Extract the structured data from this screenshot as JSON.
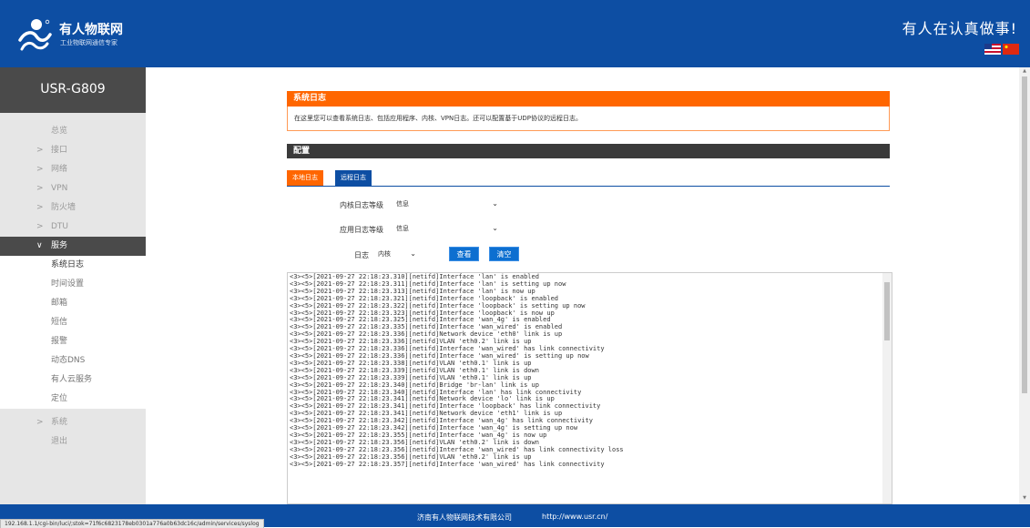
{
  "header": {
    "brand_title": "有人物联网",
    "brand_subtitle": "工业物联网通信专家",
    "slogan": "有人在认真做事!"
  },
  "sidebar": {
    "device_name": "USR-G809",
    "items": [
      {
        "label": "总览",
        "chevron": ""
      },
      {
        "label": "接口",
        "chevron": ">"
      },
      {
        "label": "网络",
        "chevron": ">"
      },
      {
        "label": "VPN",
        "chevron": ">"
      },
      {
        "label": "防火墙",
        "chevron": ">"
      },
      {
        "label": "DTU",
        "chevron": ">"
      },
      {
        "label": "服务",
        "chevron": "∨"
      },
      {
        "label": "系统日志"
      },
      {
        "label": "时间设置"
      },
      {
        "label": "邮箱"
      },
      {
        "label": "短信"
      },
      {
        "label": "报警"
      },
      {
        "label": "动态DNS"
      },
      {
        "label": "有人云服务"
      },
      {
        "label": "定位"
      },
      {
        "label": "系统",
        "chevron": ">"
      },
      {
        "label": "退出"
      }
    ]
  },
  "main": {
    "card_title": "系统日志",
    "card_desc": "在这里您可以查看系统日志、包括应用程序、内核、VPN日志。还可以配置基于UDP协议的远程日志。",
    "section_title": "配置",
    "tabs": [
      {
        "label": "本地日志"
      },
      {
        "label": "远程日志"
      }
    ],
    "kernel_level_label": "内核日志等级",
    "kernel_level_value": "信息",
    "app_level_label": "应用日志等级",
    "app_level_value": "信息",
    "log_label": "日志",
    "log_source_value": "内核",
    "view_button": "查看",
    "clear_button": "清空",
    "log_lines": "<3><5>[2021-09-27 22:18:23.310][netifd]Interface 'lan' is enabled\n<3><5>[2021-09-27 22:18:23.311][netifd]Interface 'lan' is setting up now\n<3><5>[2021-09-27 22:18:23.313][netifd]Interface 'lan' is now up\n<3><5>[2021-09-27 22:18:23.321][netifd]Interface 'loopback' is enabled\n<3><5>[2021-09-27 22:18:23.322][netifd]Interface 'loopback' is setting up now\n<3><5>[2021-09-27 22:18:23.323][netifd]Interface 'loopback' is now up\n<3><5>[2021-09-27 22:18:23.325][netifd]Interface 'wan_4g' is enabled\n<3><5>[2021-09-27 22:18:23.335][netifd]Interface 'wan_wired' is enabled\n<3><5>[2021-09-27 22:18:23.336][netifd]Network device 'eth0' link is up\n<3><5>[2021-09-27 22:18:23.336][netifd]VLAN 'eth0.2' link is up\n<3><5>[2021-09-27 22:18:23.336][netifd]Interface 'wan_wired' has link connectivity\n<3><5>[2021-09-27 22:18:23.336][netifd]Interface 'wan_wired' is setting up now\n<3><5>[2021-09-27 22:18:23.338][netifd]VLAN 'eth0.1' link is up\n<3><5>[2021-09-27 22:18:23.339][netifd]VLAN 'eth0.1' link is down\n<3><5>[2021-09-27 22:18:23.339][netifd]VLAN 'eth0.1' link is up\n<3><5>[2021-09-27 22:18:23.340][netifd]Bridge 'br-lan' link is up\n<3><5>[2021-09-27 22:18:23.340][netifd]Interface 'lan' has link connectivity\n<3><5>[2021-09-27 22:18:23.341][netifd]Network device 'lo' link is up\n<3><5>[2021-09-27 22:18:23.341][netifd]Interface 'loopback' has link connectivity\n<3><5>[2021-09-27 22:18:23.341][netifd]Network device 'eth1' link is up\n<3><5>[2021-09-27 22:18:23.342][netifd]Interface 'wan_4g' has link connectivity\n<3><5>[2021-09-27 22:18:23.342][netifd]Interface 'wan_4g' is setting up now\n<3><5>[2021-09-27 22:18:23.355][netifd]Interface 'wan_4g' is now up\n<3><5>[2021-09-27 22:18:23.356][netifd]VLAN 'eth0.2' link is down\n<3><5>[2021-09-27 22:18:23.356][netifd]Interface 'wan_wired' has link connectivity loss\n<3><5>[2021-09-27 22:18:23.356][netifd]VLAN 'eth0.2' link is up\n<3><5>[2021-09-27 22:18:23.357][netifd]Interface 'wan_wired' has link connectivity"
  },
  "footer": {
    "company": "济南有人物联网技术有限公司",
    "url": "http://www.usr.cn/"
  },
  "statusbar": {
    "url": "192.168.1.1/cgi-bin/luci/;stok=71f6c6823178eb0301a776a0b63dc16c/admin/services/syslog"
  },
  "colors": {
    "header_blue": "#0d4ea3",
    "accent_orange": "#ff6600",
    "sidebar_dark": "#4a4a4a"
  }
}
